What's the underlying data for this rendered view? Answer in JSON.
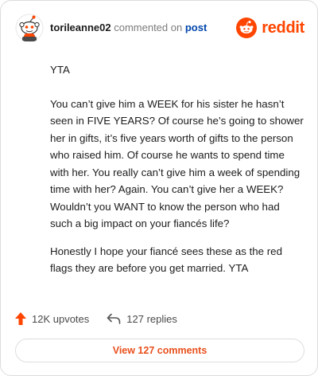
{
  "header": {
    "username": "torileanne02",
    "action_text": "commented on",
    "target": "post",
    "brand": "reddit"
  },
  "comment": {
    "paragraphs": [
      "YTA",
      "You can’t give him a WEEK for his sister he hasn’t seen in FIVE YEARS? Of course he’s going to shower her in gifts, it’s five years worth of gifts to the person who raised him. Of course he wants to spend time with her. You really can’t give him a week of spending time with her? Again. You can’t give her a WEEK? Wouldn’t you WANT to know the person who had such a big impact on your fiancés life?",
      "Honestly I hope your fiancé sees these as the red flags they are before you get married. YTA"
    ]
  },
  "stats": {
    "upvotes": "12K upvotes",
    "replies": "127 replies"
  },
  "footer": {
    "view_comments": "View 127 comments"
  },
  "colors": {
    "brand_orange": "#ff4500",
    "link_blue": "#0045ac",
    "button_text": "#e8501c"
  },
  "icons": {
    "avatar": "snoo-avatar",
    "brand": "reddit-logo-icon",
    "upvote": "upvote-arrow-icon",
    "reply": "reply-arrow-icon"
  }
}
